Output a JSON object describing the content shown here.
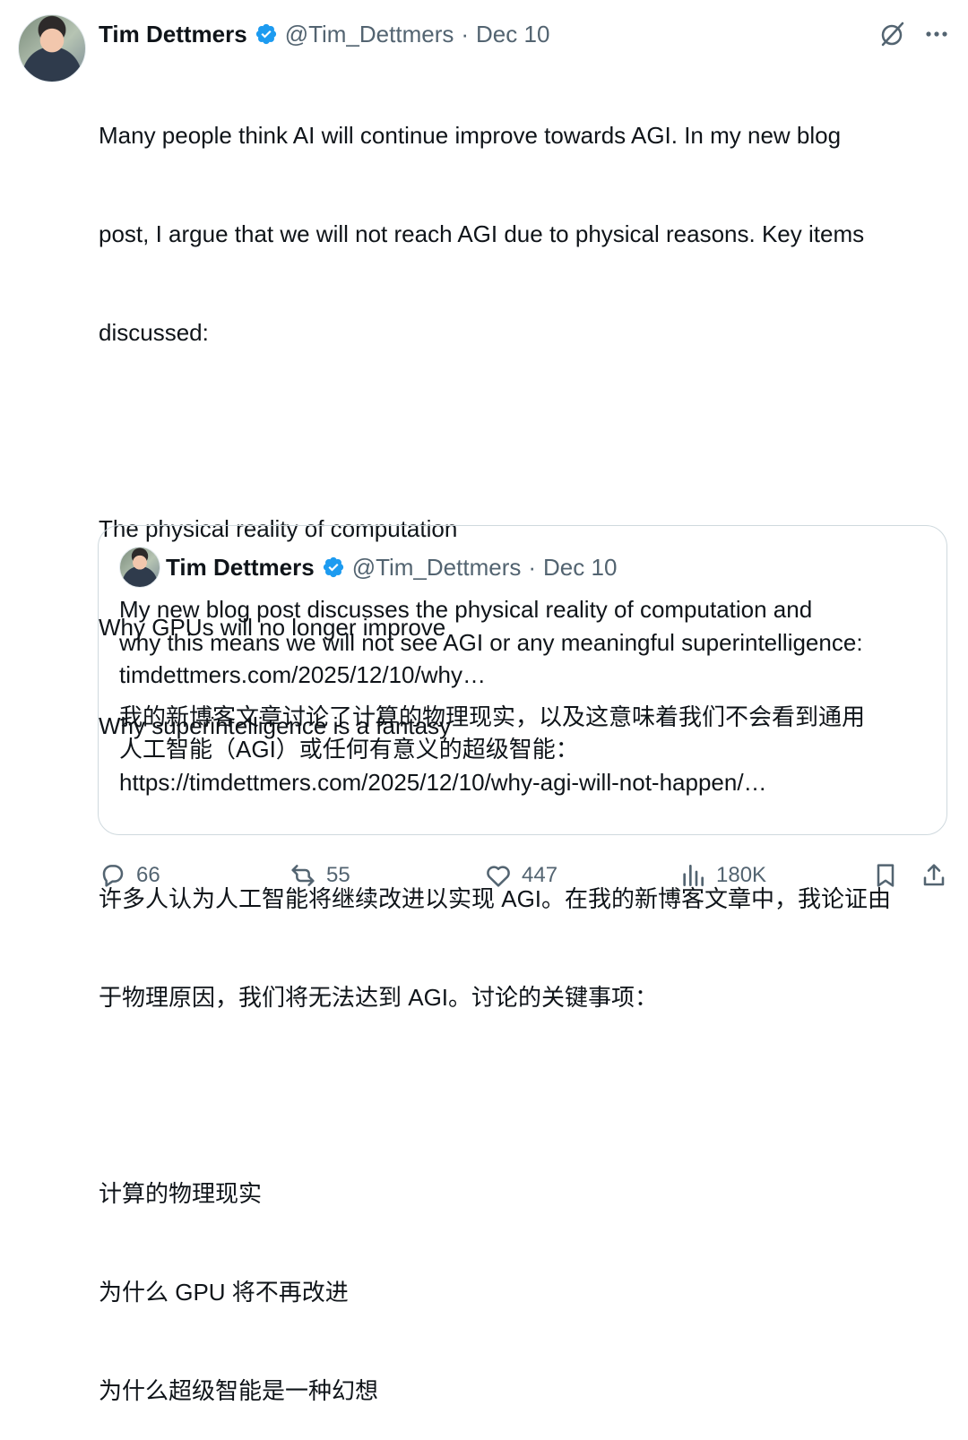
{
  "author": {
    "name": "Tim Dettmers",
    "handle": "@Tim_Dettmers",
    "separator": "·",
    "date": "Dec 10"
  },
  "tweet": {
    "en_lines": [
      "Many people think AI will continue improve towards AGI. In my new blog",
      "post, I argue that we will not reach AGI due to physical reasons. Key items",
      "discussed:"
    ],
    "en_items": [
      "The physical reality of computation",
      "Why GPUs will no longer improve",
      "Why superintelligence is a fantasy"
    ],
    "zh_lines": [
      "许多人认为人工智能将继续改进以实现 AGI。在我的新博客文章中，我论证由",
      "于物理原因，我们将无法达到 AGI。讨论的关键事项："
    ],
    "zh_items": [
      "计算的物理现实",
      "为什么 GPU 将不再改进",
      "为什么超级智能是一种幻想"
    ]
  },
  "quote": {
    "name": "Tim Dettmers",
    "handle": "@Tim_Dettmers",
    "separator": "·",
    "date": "Dec 10",
    "en_lines": [
      "My new blog post discusses the physical reality of computation and",
      "why this means we will not see AGI or any meaningful superintelligence:",
      "timdettmers.com/2025/12/10/why…"
    ],
    "zh_lines": [
      "我的新博客文章讨论了计算的物理现实，以及这意味着我们不会看到通用",
      "人工智能（AGI）或任何有意义的超级智能：",
      "https://timdettmers.com/2025/12/10/why-agi-will-not-happen/…"
    ]
  },
  "actions": {
    "replies": "66",
    "reposts": "55",
    "likes": "447",
    "views": "180K"
  },
  "icons": {
    "verified": "verified-badge-icon",
    "grok": "grok-icon",
    "more": "more-dots-icon",
    "reply": "reply-icon",
    "repost": "repost-icon",
    "like": "heart-icon",
    "views": "views-chart-icon",
    "bookmark": "bookmark-icon",
    "share": "share-icon"
  },
  "colors": {
    "text": "#0f1419",
    "secondary": "#536471",
    "verified": "#1d9bf0",
    "border": "#cfd9de"
  }
}
